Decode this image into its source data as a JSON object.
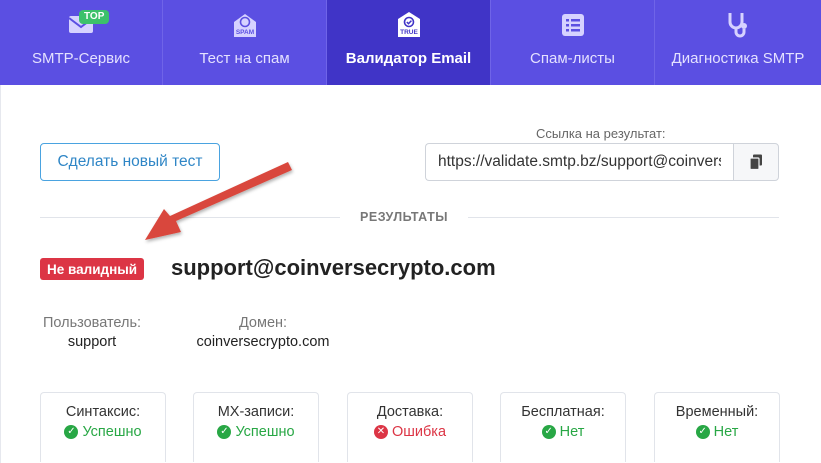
{
  "nav": {
    "tabs": [
      {
        "label": "SMTP-Сервис",
        "icon": "envelope-icon",
        "badge": "TOP",
        "active": false
      },
      {
        "label": "Тест на спам",
        "icon": "spam-envelope-icon",
        "icon_text": "SPAM",
        "active": false
      },
      {
        "label": "Валидатор Email",
        "icon": "true-shield-icon",
        "icon_text": "TRUE",
        "active": true
      },
      {
        "label": "Спам-листы",
        "icon": "list-icon",
        "active": false
      },
      {
        "label": "Диагностика SMTP",
        "icon": "stethoscope-icon",
        "active": false
      }
    ]
  },
  "toolbar": {
    "new_test_label": "Сделать новый тест",
    "link_label": "Ссылка на результат:",
    "link_value": "https://validate.smtp.bz/support@coinversecrypto.com",
    "copy_icon": "copy-icon"
  },
  "results": {
    "section_title": "РЕЗУЛЬТАТЫ",
    "status": "Не валидный",
    "email": "support@coinversecrypto.com",
    "user_label": "Пользователь:",
    "user_value": "support",
    "domain_label": "Домен:",
    "domain_value": "coinversecrypto.com"
  },
  "checks": [
    {
      "label": "Синтаксис:",
      "value": "Успешно",
      "status": "ok"
    },
    {
      "label": "MX-записи:",
      "value": "Успешно",
      "status": "ok"
    },
    {
      "label": "Доставка:",
      "value": "Ошибка",
      "status": "error"
    },
    {
      "label": "Бесплатная:",
      "value": "Нет",
      "status": "ok"
    },
    {
      "label": "Временный:",
      "value": "Нет",
      "status": "ok"
    }
  ],
  "colors": {
    "nav_bg": "#5b4fe2",
    "nav_active": "#4034c7",
    "accent_blue": "#4aa3e0",
    "success": "#28a745",
    "error": "#dc3545",
    "annotation_arrow": "#d9473c"
  }
}
